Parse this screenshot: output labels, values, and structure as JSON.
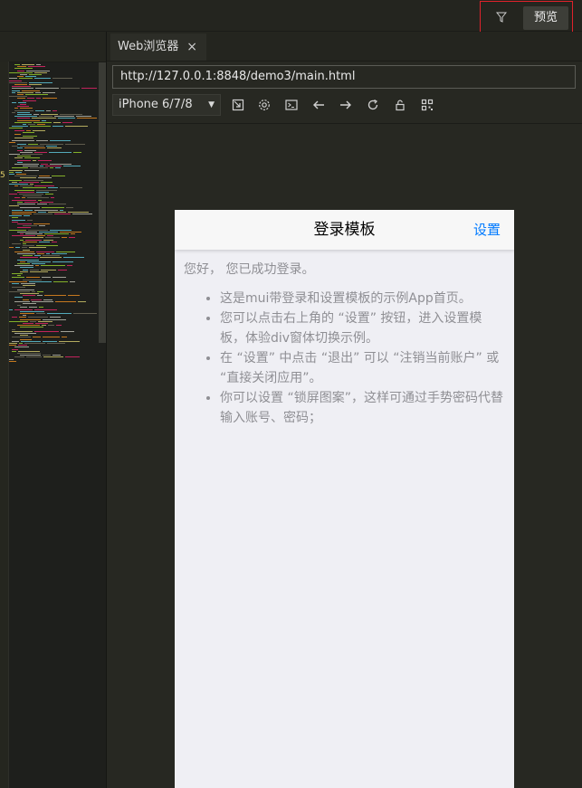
{
  "topbar": {
    "filter_icon": "filter-icon",
    "preview_label": "预览"
  },
  "browser": {
    "tab_label": "Web浏览器",
    "tab_close": "×",
    "url": "http://127.0.0.1:8848/demo3/main.html",
    "device": "iPhone 6/7/8",
    "device_caret": "▼",
    "tools": [
      "screen-rotate-icon",
      "settings-icon",
      "console-icon",
      "back-arrow-icon",
      "forward-arrow-icon",
      "reload-icon",
      "lock-icon",
      "qrcode-icon"
    ]
  },
  "editor": {
    "gutter_mark": "5"
  },
  "phone": {
    "title": "登录模板",
    "settings": "设置",
    "greeting": "您好，  您已成功登录。",
    "items": [
      "这是mui带登录和设置模板的示例App首页。",
      "您可以点击右上角的 “设置” 按钮，进入设置模板，体验div窗体切换示例。",
      "在 “设置” 中点击 “退出” 可以 “注销当前账户” 或 “直接关闭应用”。",
      "你可以设置 “锁屏图案”，这样可通过手势密码代替输入账号、密码；"
    ]
  },
  "colors": {
    "accent": "#007aff",
    "highlight": "#e0222b",
    "editor_bg": "#272822"
  }
}
